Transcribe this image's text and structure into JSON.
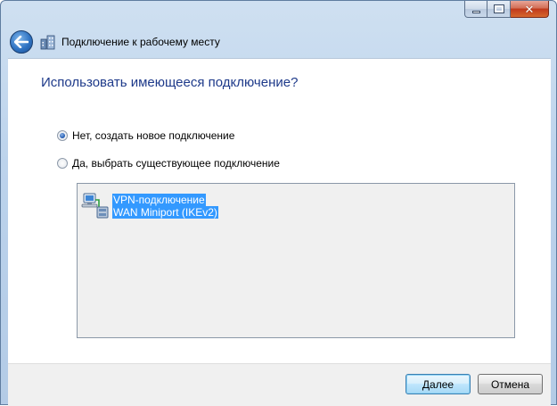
{
  "window": {
    "title": "Подключение к рабочему месту",
    "accent_color": "#1e3a8a"
  },
  "caption_buttons": {
    "minimize_icon": "minimize-icon",
    "maximize_icon": "maximize-icon",
    "close_icon": "close-icon",
    "close_glyph": "✕"
  },
  "wizard": {
    "heading": "Использовать имеющееся подключение?",
    "options": [
      {
        "label": "Нет, создать новое подключение",
        "selected": true
      },
      {
        "label": "Да, выбрать существующее подключение",
        "selected": false
      }
    ],
    "connections": [
      {
        "name": "VPN-подключение",
        "device": "WAN Miniport (IKEv2)",
        "icon": "network-connection-icon",
        "selected": true
      }
    ]
  },
  "footer": {
    "next_label": "Далее",
    "cancel_label": "Отмена"
  }
}
